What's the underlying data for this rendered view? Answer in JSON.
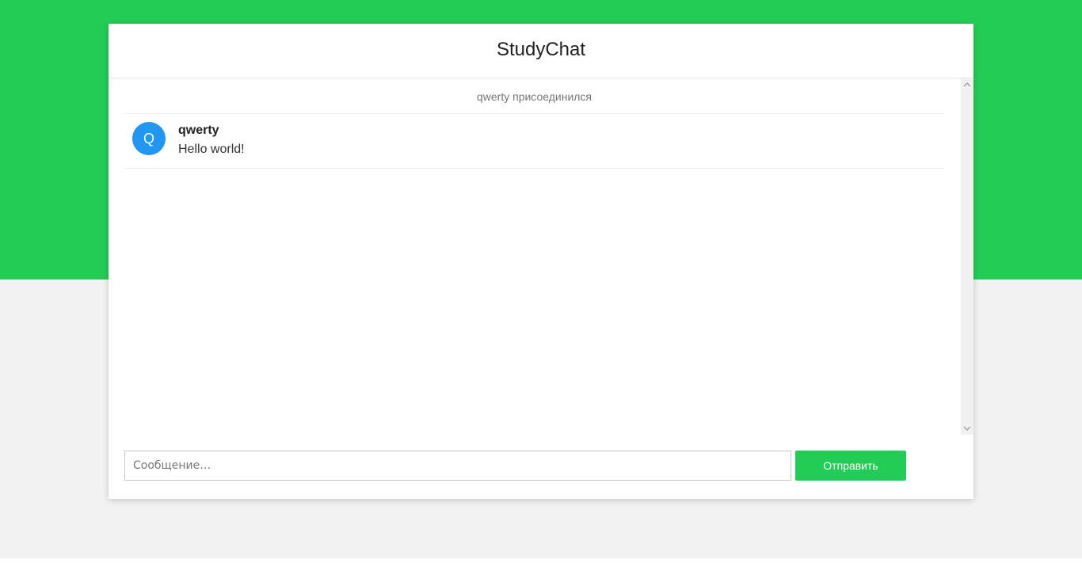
{
  "header": {
    "title": "StudyChat"
  },
  "messages": {
    "system": [
      {
        "text": "qwerty присоединился"
      }
    ],
    "items": [
      {
        "avatar_letter": "Q",
        "author": "qwerty",
        "text": "Hello world!"
      }
    ]
  },
  "composer": {
    "placeholder": "Сообщение…",
    "value": "",
    "send_label": "Отправить"
  },
  "colors": {
    "brand_green": "#22cc55",
    "avatar_blue": "#2196f3",
    "page_bg": "#f2f2f2"
  },
  "icons": {
    "scroll_up": "chevron-up-icon",
    "scroll_down": "chevron-down-icon"
  }
}
